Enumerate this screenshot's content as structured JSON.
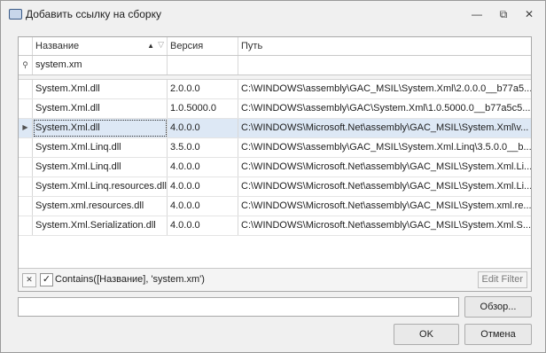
{
  "window": {
    "title": "Добавить ссылку на сборку",
    "minimize_glyph": "—",
    "restore_glyph": "⧉",
    "close_glyph": "✕"
  },
  "grid": {
    "columns": [
      {
        "label": "Название"
      },
      {
        "label": "Версия"
      },
      {
        "label": "Путь"
      }
    ],
    "filter_row": {
      "name_value": "system.xm",
      "version_value": "",
      "path_value": ""
    },
    "rows": [
      {
        "name": "System.Xml.dll",
        "version": "2.0.0.0",
        "path": "C:\\WINDOWS\\assembly\\GAC_MSIL\\System.Xml\\2.0.0.0__b77a5..."
      },
      {
        "name": "System.Xml.dll",
        "version": "1.0.5000.0",
        "path": "C:\\WINDOWS\\assembly\\GAC\\System.Xml\\1.0.5000.0__b77a5c5..."
      },
      {
        "name": "System.Xml.dll",
        "version": "4.0.0.0",
        "path": "C:\\WINDOWS\\Microsoft.Net\\assembly\\GAC_MSIL\\System.Xml\\v...",
        "selected": true
      },
      {
        "name": "System.Xml.Linq.dll",
        "version": "3.5.0.0",
        "path": "C:\\WINDOWS\\assembly\\GAC_MSIL\\System.Xml.Linq\\3.5.0.0__b..."
      },
      {
        "name": "System.Xml.Linq.dll",
        "version": "4.0.0.0",
        "path": "C:\\WINDOWS\\Microsoft.Net\\assembly\\GAC_MSIL\\System.Xml.Li..."
      },
      {
        "name": "System.Xml.Linq.resources.dll",
        "version": "4.0.0.0",
        "path": "C:\\WINDOWS\\Microsoft.Net\\assembly\\GAC_MSIL\\System.Xml.Li..."
      },
      {
        "name": "System.xml.resources.dll",
        "version": "4.0.0.0",
        "path": "C:\\WINDOWS\\Microsoft.Net\\assembly\\GAC_MSIL\\System.xml.re..."
      },
      {
        "name": "System.Xml.Serialization.dll",
        "version": "4.0.0.0",
        "path": "C:\\WINDOWS\\Microsoft.Net\\assembly\\GAC_MSIL\\System.Xml.S..."
      }
    ],
    "footer": {
      "filter_text": "Contains([Название], 'system.xm')",
      "edit_filter_label": "Edit Filter",
      "clear_glyph": "✕",
      "check_glyph": "✓"
    },
    "icons": {
      "sort": "sort-ascending-icon",
      "column_filter": "funnel-icon",
      "row_indicator": "row-pointer-icon"
    }
  },
  "path_field": {
    "value": ""
  },
  "buttons": {
    "browse_label": "Обзор...",
    "ok_label": "OK",
    "cancel_label": "Отмена"
  },
  "colors": {
    "selected_row": "#dde8f5",
    "border": "#a9a9a9"
  }
}
